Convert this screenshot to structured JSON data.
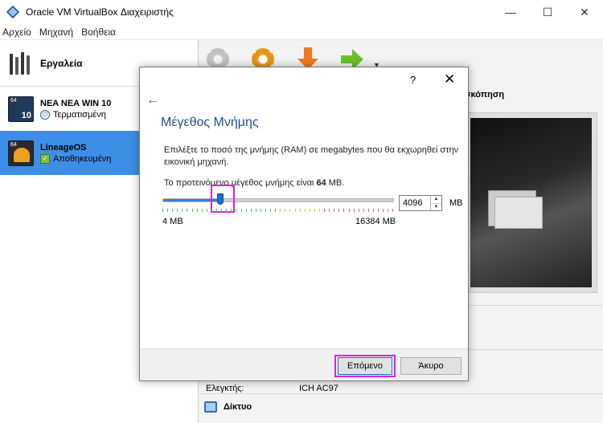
{
  "window": {
    "title": "Oracle VM VirtualBox Διαχειριστής",
    "minimize": "—",
    "maximize": "☐",
    "close": "✕"
  },
  "menu": [
    "Αρχείο",
    "Μηχανή",
    "Βοήθεια"
  ],
  "sidebar": {
    "tools_label": "Εργαλεία",
    "vms": [
      {
        "name": "NEA  NEA WIN 10",
        "state": "Τερματισμένη",
        "badge": "64",
        "num": "10"
      },
      {
        "name": "LineageOS",
        "state": "Αποθηκευμένη",
        "badge": "64"
      }
    ]
  },
  "details": {
    "preview_title": "σκόπηση",
    "audio_controller_label": "Ελεγκτής:",
    "audio_controller_value": "ICH AC97",
    "network_label": "Δίκτυο"
  },
  "dialog": {
    "help": "?",
    "close": "✕",
    "back": "←",
    "heading": "Μέγεθος Μνήμης",
    "description": "Επιλέξτε το ποσό της μνήμης (RAM) σε megabytes που θα εκχωρηθεί στην εικονική μηχανή.",
    "recommend_prefix": "Το προτεινόμενο μέγεθος μνήμης είναι ",
    "recommend_value": "64",
    "recommend_suffix": " MB.",
    "slider_min": "4 MB",
    "slider_max": "16384 MB",
    "memory_value": "4096",
    "memory_fraction": 0.25,
    "unit": "MB",
    "next_label": "Επόμενο",
    "cancel_label": "Άκυρο"
  },
  "colors": {
    "accent": "#3d8ee6",
    "heading": "#1f4f8a",
    "highlight": "#e020d0"
  }
}
